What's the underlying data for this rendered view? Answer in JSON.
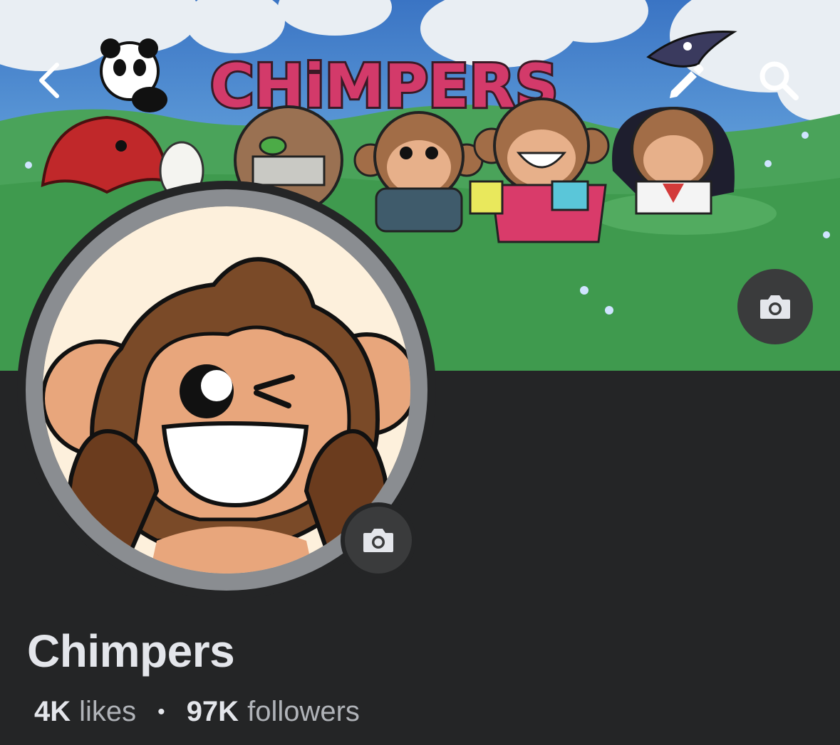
{
  "profile": {
    "name": "Chimpers",
    "likes_count": "4K",
    "likes_label": "likes",
    "followers_count": "97K",
    "followers_label": "followers",
    "separator": "•"
  },
  "cover": {
    "banner_text": "CHiMPERS"
  },
  "icons": {
    "back": "chevron-left-icon",
    "edit": "pencil-icon",
    "search": "search-icon",
    "camera": "camera-icon"
  },
  "colors": {
    "background": "#242526",
    "text_primary": "#e4e6eb",
    "text_secondary": "#b0b3b8",
    "button_bg": "#3a3b3c"
  }
}
